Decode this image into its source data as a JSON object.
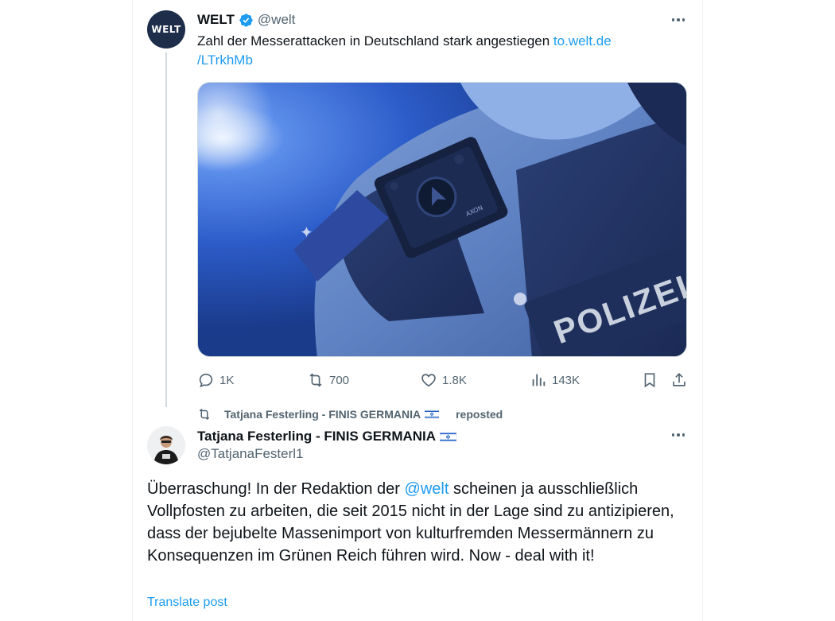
{
  "original_tweet": {
    "avatar_text": "WELT",
    "name": "WELT",
    "handle": "@welt",
    "text": "Zahl der Messerattacken in Deutschland stark angestiegen ",
    "link_line1": "to.welt.de",
    "link_line2": "/LTrkhMb",
    "image": {
      "badge_text": "POLIZEI",
      "camera_brand": "AXON"
    },
    "actions": {
      "replies": "1K",
      "reposts": "700",
      "likes": "1.8K",
      "views": "143K"
    }
  },
  "repost_indicator": {
    "text": "Tatjana Festerling - FINIS GERMANIA",
    "suffix": "reposted"
  },
  "reply_tweet": {
    "name": "Tatjana Festerling - FINIS GERMANIA",
    "handle": "@TatjanaFesterl1",
    "text_before_mention": "Überraschung! In der Redaktion der ",
    "mention": "@welt",
    "text_after_mention": " scheinen ja ausschließlich Vollpfosten zu arbeiten, die seit 2015 nicht in der Lage sind zu antizipieren, dass der bejubelte Massenimport von kulturfremden Messermännern zu Konsequenzen im Grünen Reich führen wird. Now - deal with it!",
    "translate_label": "Translate post"
  },
  "colors": {
    "accent": "#1d9bf0",
    "text": "#0f1419",
    "secondary": "#536471",
    "welt_avatar": "#1d2d4a"
  }
}
